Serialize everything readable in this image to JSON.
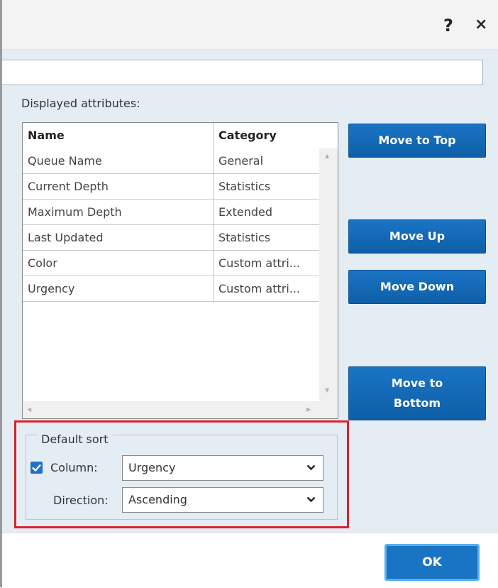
{
  "window": {
    "help_label": "?",
    "close_label": "×"
  },
  "labels": {
    "displayed_attributes": "Displayed attributes:"
  },
  "table": {
    "columns": [
      "Name",
      "Category"
    ],
    "rows": [
      {
        "name": "Queue Name",
        "category": "General"
      },
      {
        "name": "Current Depth",
        "category": "Statistics"
      },
      {
        "name": "Maximum Depth",
        "category": "Extended"
      },
      {
        "name": "Last Updated",
        "category": "Statistics"
      },
      {
        "name": "Color",
        "category": "Custom attri..."
      },
      {
        "name": "Urgency",
        "category": "Custom attri..."
      }
    ]
  },
  "buttons": {
    "move_to_top": "Move to Top",
    "move_up": "Move Up",
    "move_down": "Move Down",
    "move_to_bottom_line1": "Move to",
    "move_to_bottom_line2": "Bottom",
    "ok": "OK"
  },
  "default_sort": {
    "legend": "Default sort",
    "column_label": "Column:",
    "column_checked": true,
    "column_value": "Urgency",
    "direction_label": "Direction:",
    "direction_value": "Ascending"
  },
  "colors": {
    "accent": "#1a74c4",
    "highlight": "#d9232d",
    "panel_bg": "#e4ecf4"
  }
}
